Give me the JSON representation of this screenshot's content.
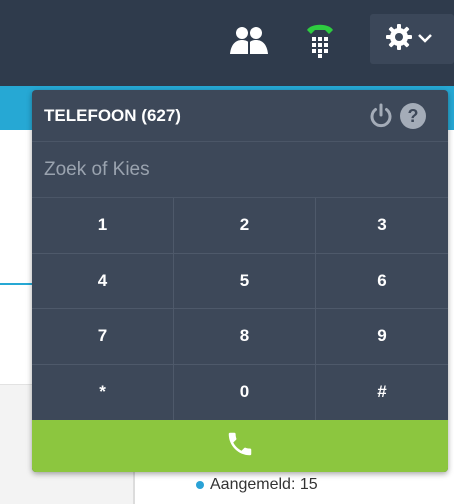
{
  "topbar": {
    "contacts_icon": "contacts-icon",
    "phone_icon": "phone-dialpad-icon",
    "settings_icon": "gear-icon",
    "chevron_icon": "chevron-down-icon"
  },
  "phone": {
    "title": "TELEFOON (627)",
    "power_icon": "power-icon",
    "help_label": "?",
    "search_placeholder": "Zoek of Kies",
    "keys": [
      "1",
      "2",
      "3",
      "4",
      "5",
      "6",
      "7",
      "8",
      "9",
      "*",
      "0",
      "#"
    ],
    "call_icon": "phone-call-icon"
  },
  "status": {
    "text": "Aangemeld: 15"
  },
  "colors": {
    "topbar": "#2f3b4c",
    "accent_blue": "#26a8d4",
    "panel": "#3d4859",
    "call_green": "#8cc63f",
    "phone_icon_green": "#2ecc40"
  }
}
